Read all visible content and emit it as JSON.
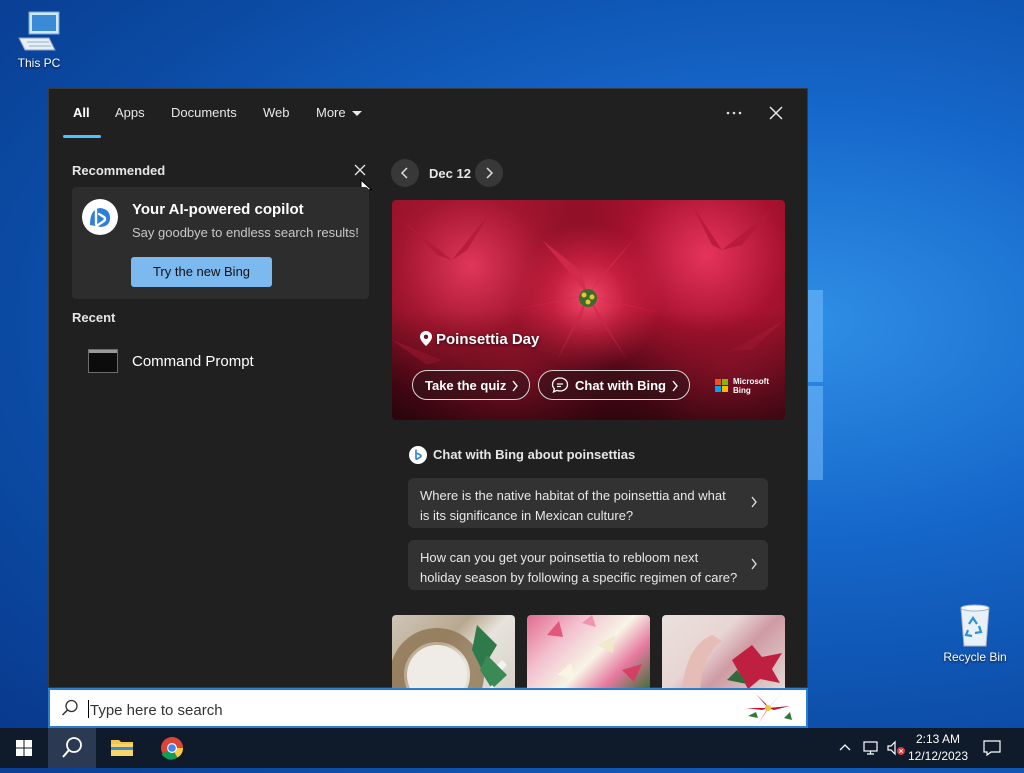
{
  "desktop": {
    "icons": [
      {
        "label": "This PC"
      },
      {
        "label": "Recycle Bin"
      }
    ]
  },
  "tabs": [
    {
      "label": "All",
      "active": true
    },
    {
      "label": "Apps"
    },
    {
      "label": "Documents"
    },
    {
      "label": "Web"
    },
    {
      "label": "More"
    }
  ],
  "recommended": {
    "heading": "Recommended",
    "card_title": "Your AI-powered copilot",
    "card_subtitle": "Say goodbye to endless search results!",
    "button_label": "Try the new Bing"
  },
  "recent": {
    "heading": "Recent",
    "items": [
      {
        "label": "Command Prompt",
        "icon": "command-prompt-icon"
      }
    ]
  },
  "highlight": {
    "date": "Dec 12",
    "title": "Poinsettia Day",
    "quiz_label": "Take the quiz",
    "chat_label": "Chat with Bing",
    "brand_line1": "Microsoft",
    "brand_line2": "Bing"
  },
  "chat": {
    "heading": "Chat with Bing about poinsettias",
    "questions": [
      "Where is the native habitat of the poinsettia and what is its significance in Mexican culture?",
      "How can you get your poinsettia to rebloom next holiday season by following a specific regimen of care?"
    ]
  },
  "search": {
    "placeholder": "Type here to search"
  },
  "taskbar": {
    "time": "2:13 AM",
    "date": "12/12/2023"
  },
  "colors": {
    "accent": "#4cc2ff",
    "panel_bg": "#202020",
    "card_bg": "#2d2d2d",
    "bing_button": "#7cb9ef"
  }
}
